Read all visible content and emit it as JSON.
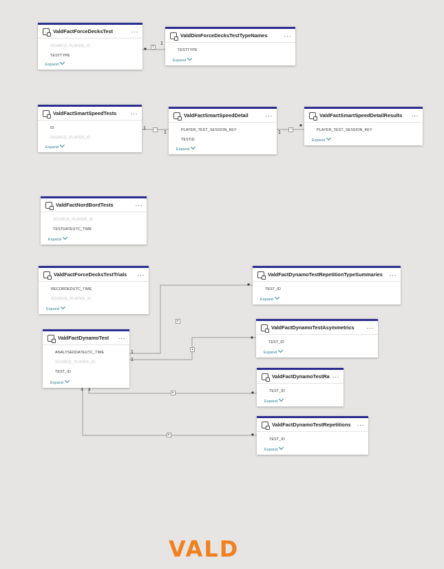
{
  "tables": {
    "force_decks_test": {
      "name": "ValdFactForceDecksTest",
      "fields": [
        "SOURCE_PLAYER_ID",
        "TESTTYPE"
      ]
    },
    "dim_force_decks_test_type_names": {
      "name": "ValdDimForceDecksTestTypeNames",
      "fields": [
        "TESTTYPE"
      ]
    },
    "smart_speed_tests": {
      "name": "ValdFactSmartSpeedTests",
      "fields": [
        "ID",
        "SOURCE_PLAYER_ID"
      ]
    },
    "smart_speed_detail": {
      "name": "ValdFactSmartSpeedDetail",
      "fields": [
        "PLAYER_TEST_SESSION_KEY",
        "TESTID"
      ]
    },
    "smart_speed_detail_results": {
      "name": "ValdFactSmartSpeedDetailResults",
      "fields": [
        "PLAYER_TEST_SESSION_KEY"
      ]
    },
    "nord_bord_tests": {
      "name": "ValdFactNordBordTests",
      "fields": [
        "SOURCE_PLAYER_ID",
        "TESTDATEUTC_TIME"
      ]
    },
    "force_decks_test_trials": {
      "name": "ValdFactForceDecksTestTrials",
      "fields": [
        "RECORDEDUTC_TIME",
        "SOURCE_PLAYER_ID"
      ]
    },
    "dynamo_test": {
      "name": "ValdFactDynamoTest",
      "fields": [
        "ANALYSEDDATEUTC_TIME",
        "SOURCE_PLAYER_ID",
        "TEST_ID"
      ]
    },
    "dynamo_rep_type_summaries": {
      "name": "ValdFactDynamoTestRepetitionTypeSummaries",
      "fields": [
        "TEST_ID"
      ]
    },
    "dynamo_asymmetrics": {
      "name": "ValdFactDynamoTestAsymmetrics",
      "fields": [
        "TEST_ID"
      ]
    },
    "dynamo_ratios": {
      "name": "ValdFactDynamoTestRat...",
      "fields": [
        "TEST_ID"
      ]
    },
    "dynamo_repetitions": {
      "name": "ValdFactDynamoTestRepetitions",
      "fields": [
        "TEST_ID"
      ]
    }
  },
  "labels": {
    "expand": "Expand",
    "more": "···",
    "one": "1",
    "many": "*"
  },
  "relationships": [
    {
      "from": "ValdFactForceDecksTest",
      "from_card": "*",
      "to": "ValdDimForceDecksTestTypeNames",
      "to_card": "1",
      "direction": "both"
    },
    {
      "from": "ValdFactSmartSpeedTests",
      "from_card": "1",
      "to": "ValdFactSmartSpeedDetail",
      "to_card": "1",
      "direction": "both"
    },
    {
      "from": "ValdFactSmartSpeedDetail",
      "from_card": "1",
      "to": "ValdFactSmartSpeedDetailResults",
      "to_card": "*",
      "direction": "both"
    },
    {
      "from": "ValdFactDynamoTest",
      "from_card": "1",
      "to": "ValdFactDynamoTestRepetitionTypeSummaries",
      "to_card": "*",
      "direction": "single"
    },
    {
      "from": "ValdFactDynamoTest",
      "from_card": "1",
      "to": "ValdFactDynamoTestAsymmetrics",
      "to_card": "*",
      "direction": "single"
    },
    {
      "from": "ValdFactDynamoTest",
      "from_card": "1",
      "to": "ValdFactDynamoTestRat...",
      "to_card": "*",
      "direction": "single"
    },
    {
      "from": "ValdFactDynamoTest",
      "from_card": "1",
      "to": "ValdFactDynamoTestRepetitions",
      "to_card": "*",
      "direction": "single"
    }
  ],
  "logo": {
    "text": "VALD",
    "color": "#f08020"
  },
  "colors": {
    "header_accent": "#2b2d8f",
    "background": "#e6e5e3",
    "expand_link": "#2a7d92"
  }
}
